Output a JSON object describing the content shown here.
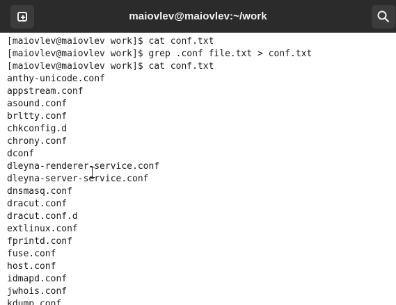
{
  "window": {
    "title": "maiovlev@maiovlev:~/work"
  },
  "icons": {
    "new_tab": "new-tab-icon",
    "search": "search-icon",
    "cursor": "text-cursor-icon"
  },
  "colors": {
    "titlebar_bg": "#2b2b2b",
    "titlebar_text": "#f2f2f2",
    "terminal_bg": "#ffffff",
    "terminal_text": "#1a1a1a"
  },
  "terminal": {
    "lines": [
      "[maiovlev@maiovlev work]$ cat conf.txt",
      "[maiovlev@maiovlev work]$ grep .conf file.txt > conf.txt",
      "[maiovlev@maiovlev work]$ cat conf.txt",
      "anthy-unicode.conf",
      "appstream.conf",
      "asound.conf",
      "brltty.conf",
      "chkconfig.d",
      "chrony.conf",
      "dconf",
      "dleyna-renderer-service.conf",
      "dleyna-server-service.conf",
      "dnsmasq.conf",
      "dracut.conf",
      "dracut.conf.d",
      "extlinux.conf",
      "fprintd.conf",
      "fuse.conf",
      "host.conf",
      "idmapd.conf",
      "jwhois.conf",
      "kdump.conf"
    ]
  }
}
